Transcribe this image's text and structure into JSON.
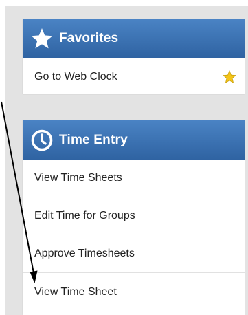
{
  "favorites": {
    "title": "Favorites",
    "icon": "star-icon",
    "items": [
      {
        "label": "Go to Web Clock",
        "icon": "favorite-star-icon"
      }
    ]
  },
  "time_entry": {
    "title": "Time Entry",
    "icon": "clock-icon",
    "items": [
      {
        "label": "View Time Sheets"
      },
      {
        "label": "Edit Time for Groups"
      },
      {
        "label": "Approve Timesheets"
      },
      {
        "label": "View Time Sheet"
      }
    ]
  },
  "colors": {
    "header_top": "#4a83c4",
    "header_bottom": "#2f63a2",
    "star": "#f5c518",
    "backdrop": "#e3e3e3"
  }
}
